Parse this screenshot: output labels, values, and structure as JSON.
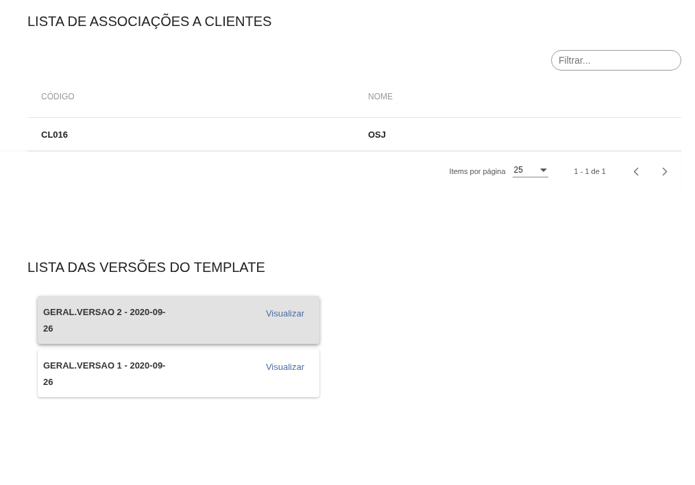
{
  "clients_section": {
    "title": "LISTA DE ASSOCIAÇÕES A CLIENTES",
    "filter": {
      "placeholder": "Filtrar..."
    },
    "table": {
      "columns": [
        "CÓDIGO",
        "NOME"
      ],
      "rows": [
        [
          "CL016",
          "OSJ"
        ]
      ]
    },
    "paginator": {
      "items_label": "Items por página",
      "page_size": "25",
      "range": "1 - 1 de 1"
    }
  },
  "versions_section": {
    "title": "LISTA DAS VERSÕES DO TEMPLATE",
    "versions": [
      {
        "name": "GERAL.VERSAO 2 - 2020-09-26",
        "action": "Visualizar",
        "selected": true
      },
      {
        "name": "GERAL.VERSAO 1 - 2020-09-26",
        "action": "Visualizar",
        "selected": false
      }
    ]
  }
}
